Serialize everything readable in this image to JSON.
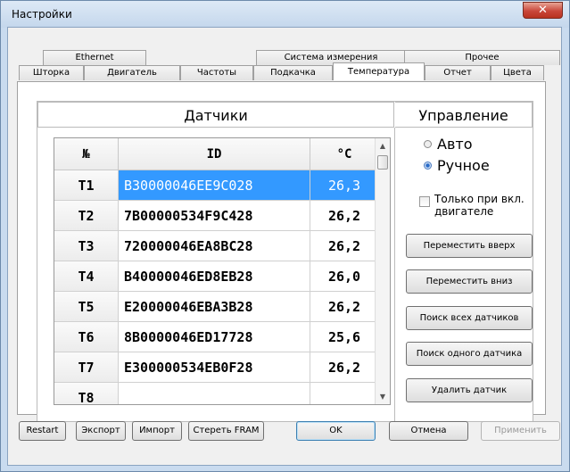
{
  "window": {
    "title": "Настройки",
    "close": "✕"
  },
  "tabs_back": [
    "Ethernet",
    "Система измерения",
    "Прочее"
  ],
  "tabs_front": [
    "Шторка",
    "Двигатель",
    "Частоты",
    "Подкачка",
    "Температура",
    "Отчет",
    "Цвета"
  ],
  "active_tab": "Температура",
  "sensors": {
    "header": "Датчики",
    "columns": [
      "№",
      "ID",
      "°C"
    ],
    "rows": [
      {
        "n": "T1",
        "id": "B30000046EE9C028",
        "t": "26,3",
        "selected": true
      },
      {
        "n": "T2",
        "id": "7B00000534F9C428",
        "t": "26,2"
      },
      {
        "n": "T3",
        "id": "720000046EA8BC28",
        "t": "26,2"
      },
      {
        "n": "T4",
        "id": "B40000046ED8EB28",
        "t": "26,0"
      },
      {
        "n": "T5",
        "id": "E20000046EBA3B28",
        "t": "26,2"
      },
      {
        "n": "T6",
        "id": "8B0000046ED17728",
        "t": "25,6"
      },
      {
        "n": "T7",
        "id": "E300000534EB0F28",
        "t": "26,2"
      },
      {
        "n": "T8",
        "id": "",
        "t": ""
      }
    ]
  },
  "control": {
    "header": "Управление",
    "auto": "Авто",
    "manual": "Ручное",
    "mode": "manual",
    "only_motor": "Только при вкл. двигателе",
    "buttons": [
      "Переместить вверх",
      "Переместить вниз",
      "Поиск всех датчиков",
      "Поиск одного датчика",
      "Удалить датчик"
    ]
  },
  "bottom": {
    "restart": "Restart",
    "export": "Экспорт",
    "import": "Импорт",
    "erase": "Стереть FRAM",
    "ok": "OK",
    "cancel": "Отмена",
    "apply": "Применить"
  }
}
